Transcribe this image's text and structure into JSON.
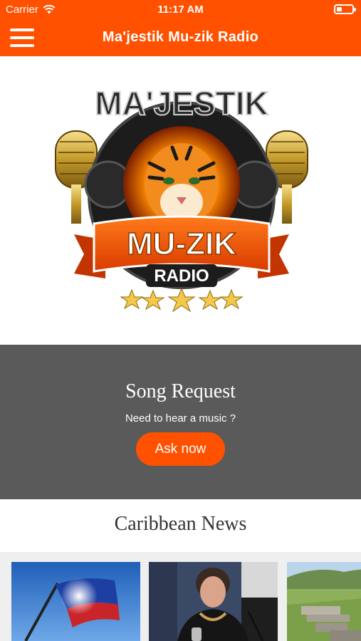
{
  "status_bar": {
    "carrier": "Carrier",
    "time": "11:17 AM",
    "wifi_icon": "wifi-icon",
    "battery_icon": "battery-icon"
  },
  "navbar": {
    "menu_icon": "hamburger-menu-icon",
    "title": "Ma'jestik Mu-zik Radio",
    "background": "#ff5100"
  },
  "logo": {
    "top_text": "MA'JESTIK",
    "banner_text": "MU-ZIK",
    "sub_text": "RADIO"
  },
  "song_request": {
    "title": "Song Request",
    "subtitle": "Need to hear a music ?",
    "button_label": "Ask now",
    "panel_color": "#5a5a5a",
    "accent": "#ff5100"
  },
  "news": {
    "heading": "Caribbean News",
    "cards": [
      {
        "image": "flag-photo"
      },
      {
        "image": "speaker-photo"
      },
      {
        "image": "landscape-photo"
      }
    ]
  }
}
